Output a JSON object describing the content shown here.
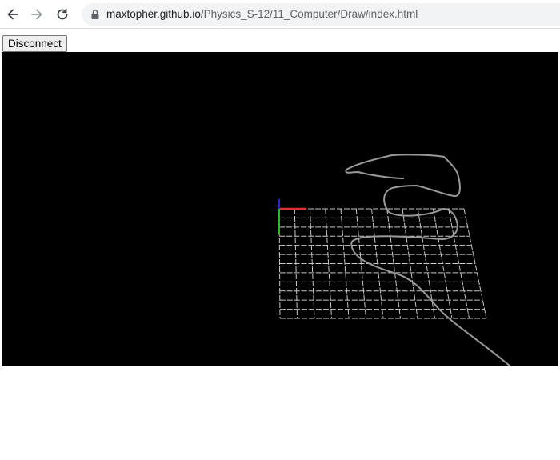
{
  "browser": {
    "url_host": "maxtopher.github.io",
    "url_path": "/Physics_S-12/11_Computer/Draw/index.html",
    "icons": {
      "back": "back-arrow-icon",
      "forward": "forward-arrow-icon",
      "reload": "reload-icon",
      "lock": "lock-icon"
    }
  },
  "page": {
    "disconnect_label": "Disconnect"
  },
  "scene": {
    "background": "#000000",
    "grid_color": "#c8c8c8",
    "stroke_color": "#9a9a9a",
    "axis_colors": {
      "x": "#e03030",
      "y": "#22c022",
      "z": "#2a2ad0"
    }
  }
}
